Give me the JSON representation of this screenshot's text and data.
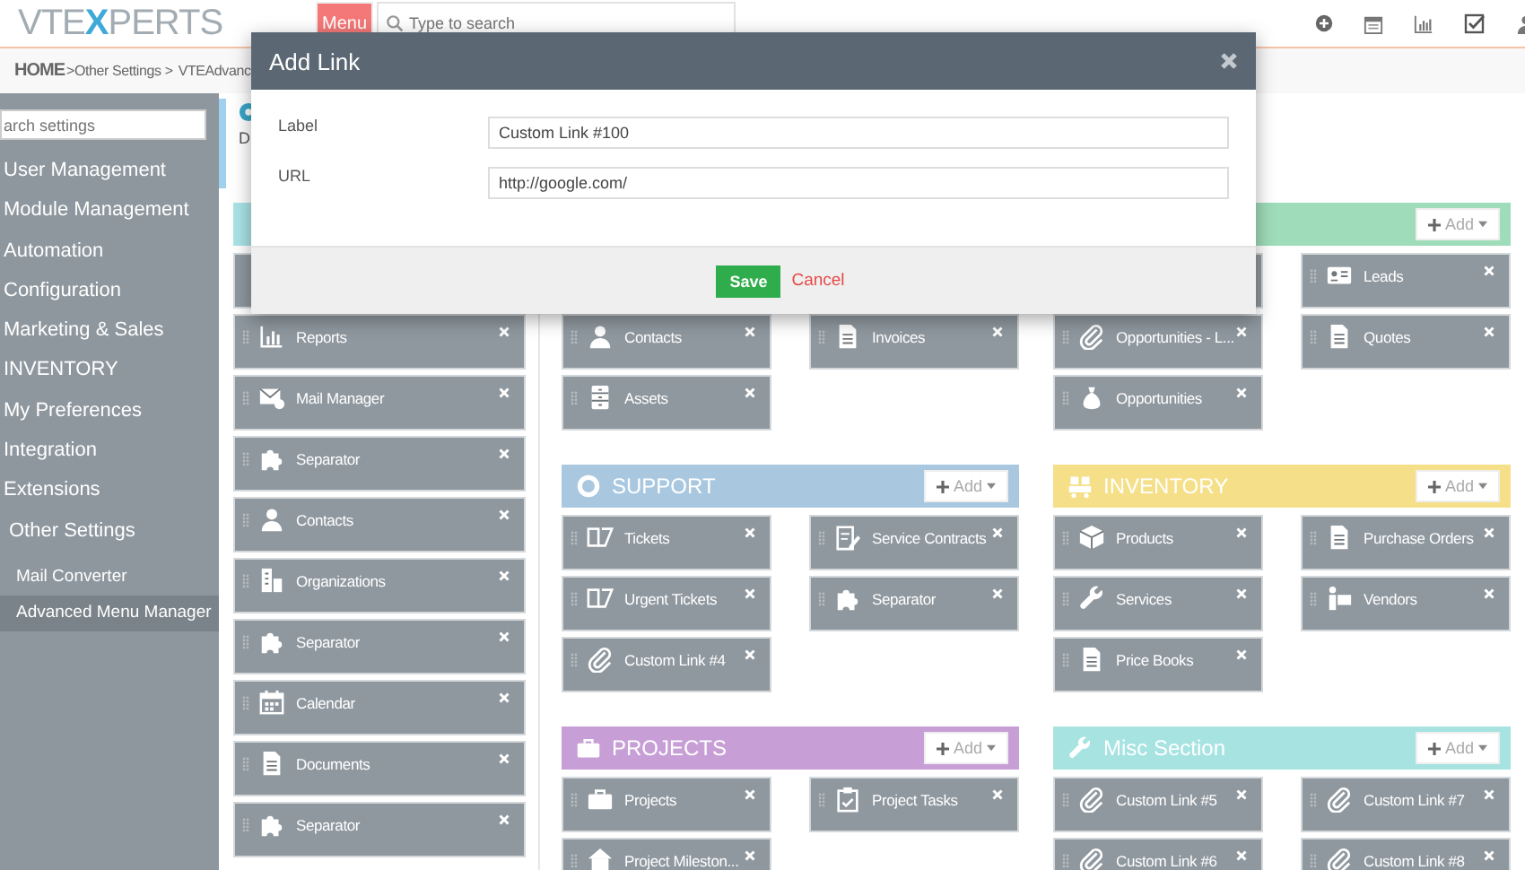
{
  "header": {
    "logo": {
      "start": "VTE",
      "accent": "X",
      "end": "PERTS"
    },
    "menu_button": "Menu",
    "search": {
      "placeholder": "Type to search"
    }
  },
  "breadcrumb": {
    "home": "HOME",
    "path": ">Other Settings >",
    "current": "VTEAdvanc"
  },
  "sidebar": {
    "search": {
      "placeholder": "arch settings"
    },
    "items": [
      {
        "label": "User Management",
        "selected": false
      },
      {
        "label": "Module Management",
        "selected": false
      },
      {
        "label": "Automation",
        "selected": false
      },
      {
        "label": "Configuration",
        "selected": false
      },
      {
        "label": "Marketing & Sales",
        "selected": false
      },
      {
        "label": "INVENTORY",
        "selected": false
      },
      {
        "label": "My Preferences",
        "selected": false
      },
      {
        "label": "Integration",
        "selected": false
      },
      {
        "label": "Extensions",
        "selected": false
      },
      {
        "label": "Other Settings",
        "selected": false,
        "children": [
          {
            "label": "Mail Converter",
            "selected": false
          },
          {
            "label": "Advanced Menu Manager",
            "selected": true
          }
        ]
      }
    ]
  },
  "page_header": {
    "text": "D"
  },
  "columns": [
    {
      "kind": "single",
      "sections": [
        {
          "header": {
            "color": "#a9e3e6"
          },
          "tiles": [
            {
              "kind": "blank"
            },
            {
              "kind": "chart",
              "label": "Reports"
            },
            {
              "kind": "mail",
              "label": "Mail Manager"
            },
            {
              "kind": "puzzle",
              "label": "Separator"
            },
            {
              "kind": "person",
              "label": "Contacts"
            },
            {
              "kind": "building",
              "label": "Organizations"
            },
            {
              "kind": "puzzle",
              "label": "Separator"
            },
            {
              "kind": "calendar",
              "label": "Calendar"
            },
            {
              "kind": "document",
              "label": "Documents"
            },
            {
              "kind": "puzzle",
              "label": "Separator"
            }
          ]
        }
      ]
    },
    {
      "kind": "double",
      "sections": [
        {
          "tiles": [
            {
              "kind": "covered"
            },
            {
              "kind": "covered"
            },
            {
              "kind": "person",
              "label": "Contacts"
            },
            {
              "kind": "invoice",
              "label": "Invoices"
            },
            {
              "kind": "assets",
              "label": "Assets"
            }
          ]
        },
        {
          "header": {
            "color": "#a9c8e0",
            "kind": "lifebuoy",
            "title": "SUPPORT",
            "add": "Add"
          },
          "tiles": [
            {
              "kind": "ticket",
              "label": "Tickets"
            },
            {
              "kind": "form",
              "label": "Service Contracts"
            },
            {
              "kind": "ticket",
              "label": "Urgent Tickets"
            },
            {
              "kind": "puzzle",
              "label": "Separator"
            },
            {
              "kind": "link",
              "label": "Custom Link #4"
            }
          ]
        },
        {
          "header": {
            "color": "#c79fd6",
            "kind": "briefcase",
            "title": "PROJECTS",
            "add": "Add"
          },
          "tiles": [
            {
              "kind": "briefcase",
              "label": "Projects"
            },
            {
              "kind": "clipboard",
              "label": "Project Tasks"
            },
            {
              "kind": "milestone",
              "label": "Project Mileston..."
            }
          ]
        }
      ]
    },
    {
      "kind": "double",
      "sections": [
        {
          "header": {
            "color": "#9fdcb9",
            "add": "Add"
          },
          "tiles": [
            {
              "kind": "blank"
            },
            {
              "kind": "card",
              "label": "Leads"
            },
            {
              "kind": "link",
              "label": "Opportunities - L..."
            },
            {
              "kind": "quote",
              "label": "Quotes"
            },
            {
              "kind": "money",
              "label": "Opportunities"
            }
          ]
        },
        {
          "header": {
            "color": "#f5df88",
            "kind": "cart",
            "title": "INVENTORY",
            "add": "Add"
          },
          "tiles": [
            {
              "kind": "box",
              "label": "Products"
            },
            {
              "kind": "po",
              "label": "Purchase Orders"
            },
            {
              "kind": "service",
              "label": "Services"
            },
            {
              "kind": "vendor",
              "label": "Vendors"
            },
            {
              "kind": "pricebook",
              "label": "Price Books"
            }
          ]
        },
        {
          "header": {
            "color": "#a6e3e1",
            "kind": "wrench",
            "title": "Misc Section",
            "add": "Add"
          },
          "tiles": [
            {
              "kind": "link",
              "label": "Custom Link #5"
            },
            {
              "kind": "link",
              "label": "Custom Link #7"
            },
            {
              "kind": "link",
              "label": "Custom Link #6"
            },
            {
              "kind": "link",
              "label": "Custom Link #8"
            }
          ]
        }
      ]
    }
  ],
  "dialog": {
    "title": "Add Link",
    "fields": [
      {
        "label": "Label",
        "value": "Custom Link #100"
      },
      {
        "label": "URL",
        "value": "http://google.com/"
      }
    ],
    "save": "Save",
    "cancel": "Cancel"
  }
}
